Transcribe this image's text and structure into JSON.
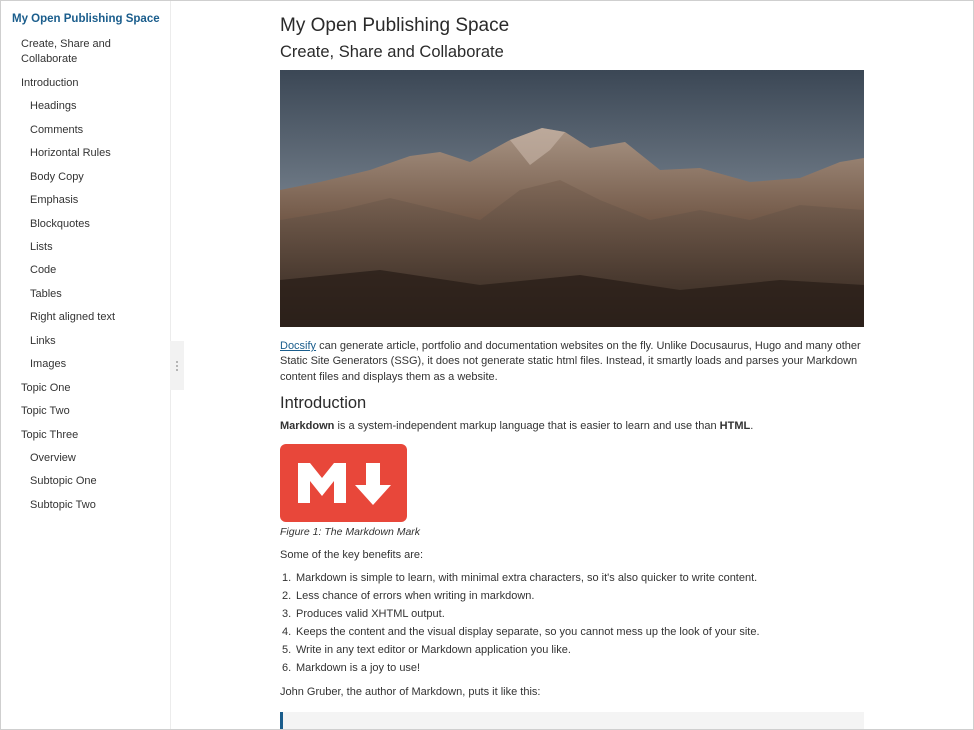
{
  "sidebar": {
    "title": "My Open Publishing Space",
    "items": [
      {
        "label": "Create, Share and",
        "label2": "Collaborate",
        "level": 1
      },
      {
        "label": "Introduction",
        "level": 1
      },
      {
        "label": "Headings",
        "level": 2
      },
      {
        "label": "Comments",
        "level": 2
      },
      {
        "label": "Horizontal Rules",
        "level": 2
      },
      {
        "label": "Body Copy",
        "level": 2
      },
      {
        "label": "Emphasis",
        "level": 2
      },
      {
        "label": "Blockquotes",
        "level": 2
      },
      {
        "label": "Lists",
        "level": 2
      },
      {
        "label": "Code",
        "level": 2
      },
      {
        "label": "Tables",
        "level": 2
      },
      {
        "label": "Right aligned text",
        "level": 2
      },
      {
        "label": "Links",
        "level": 2
      },
      {
        "label": "Images",
        "level": 2
      },
      {
        "label": "Topic One",
        "level": 1
      },
      {
        "label": "Topic Two",
        "level": 1
      },
      {
        "label": "Topic Three",
        "level": 1
      },
      {
        "label": "Overview",
        "level": 2
      },
      {
        "label": "Subtopic One",
        "level": 2
      },
      {
        "label": "Subtopic Two",
        "level": 2
      }
    ]
  },
  "main": {
    "title": "My Open Publishing Space",
    "subtitle": "Create, Share and Collaborate",
    "intro_link": "Docsify",
    "intro_text": " can generate article, portfolio and documentation websites on the fly. Unlike Docusaurus, Hugo and many other Static Site Generators (SSG), it does not generate static html files. Instead, it smartly loads and parses your Markdown content files and displays them as a website.",
    "section_heading": "Introduction",
    "markdown_bold": "Markdown",
    "markdown_mid": " is a system-independent markup language that is easier to learn and use than ",
    "html_bold": "HTML",
    "markdown_end": ".",
    "figure_caption": "Figure 1: The Markdown Mark",
    "benefits_intro": "Some of the key benefits are:",
    "benefits": [
      {
        "num": "1.",
        "text": "Markdown is simple to learn, with minimal extra characters, so it's also quicker to write content."
      },
      {
        "num": "2.",
        "text": "Less chance of errors when writing in markdown."
      },
      {
        "num": "3.",
        "text": "Produces valid XHTML output."
      },
      {
        "num": "4.",
        "text": "Keeps the content and the visual display separate, so you cannot mess up the look of your site."
      },
      {
        "num": "5.",
        "text": "Write in any text editor or Markdown application you like."
      },
      {
        "num": "6.",
        "text": "Markdown is a joy to use!"
      }
    ],
    "gruber_text": "John Gruber, the author of Markdown, puts it like this:"
  },
  "colors": {
    "accent": "#1a5d8c",
    "markdown_logo": "#e8473a"
  }
}
